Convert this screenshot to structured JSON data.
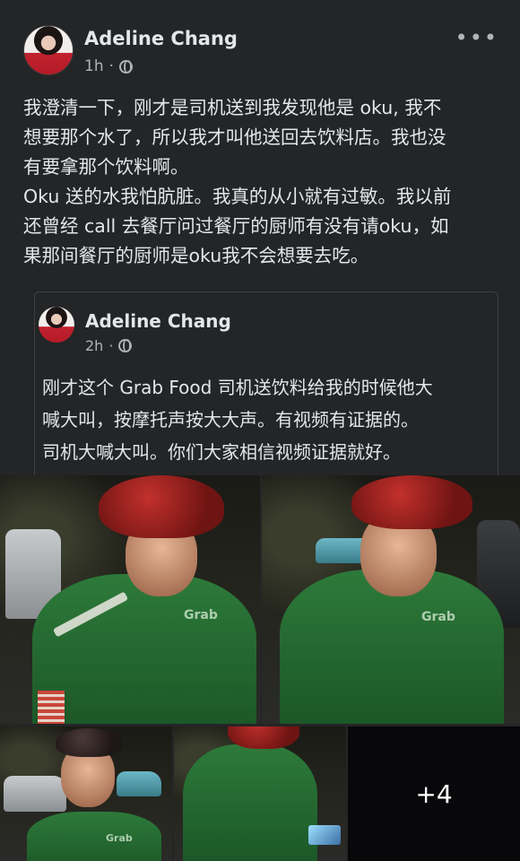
{
  "post": {
    "author": "Adeline Chang",
    "time": "1h",
    "more_icon": "more-dots-icon",
    "privacy_icon": "globe-icon",
    "text": "我澄清一下，刚才是司机送到我发现他是 oku, 我不\n想要那个水了，所以我才叫他送回去饮料店。我也没\n有要拿那个饮料啊。\nOku 送的水我怕肮脏。我真的从小就有过敏。我以前\n还曾经 call 去餐厅问过餐厅的厨师有没有请oku，如\n果那间餐厅的厨师是oku我不会想要去吃。"
  },
  "shared_post": {
    "author": "Adeline Chang",
    "time": "2h",
    "privacy_icon": "globe-icon",
    "text": "刚才这个 Grab Food 司机送饮料给我的时候他大\n喊大叫，按摩托声按大大声。有视频有证据的。\n司机大喊大叫。你们大家相信视频证据就好。"
  },
  "photos": {
    "more_count": "+4",
    "jacket_logo": "Grab"
  },
  "colors": {
    "background": "#242526",
    "text": "#e4e6eb",
    "secondary": "#b0b3b8",
    "grab_green": "#2d7a3a"
  }
}
